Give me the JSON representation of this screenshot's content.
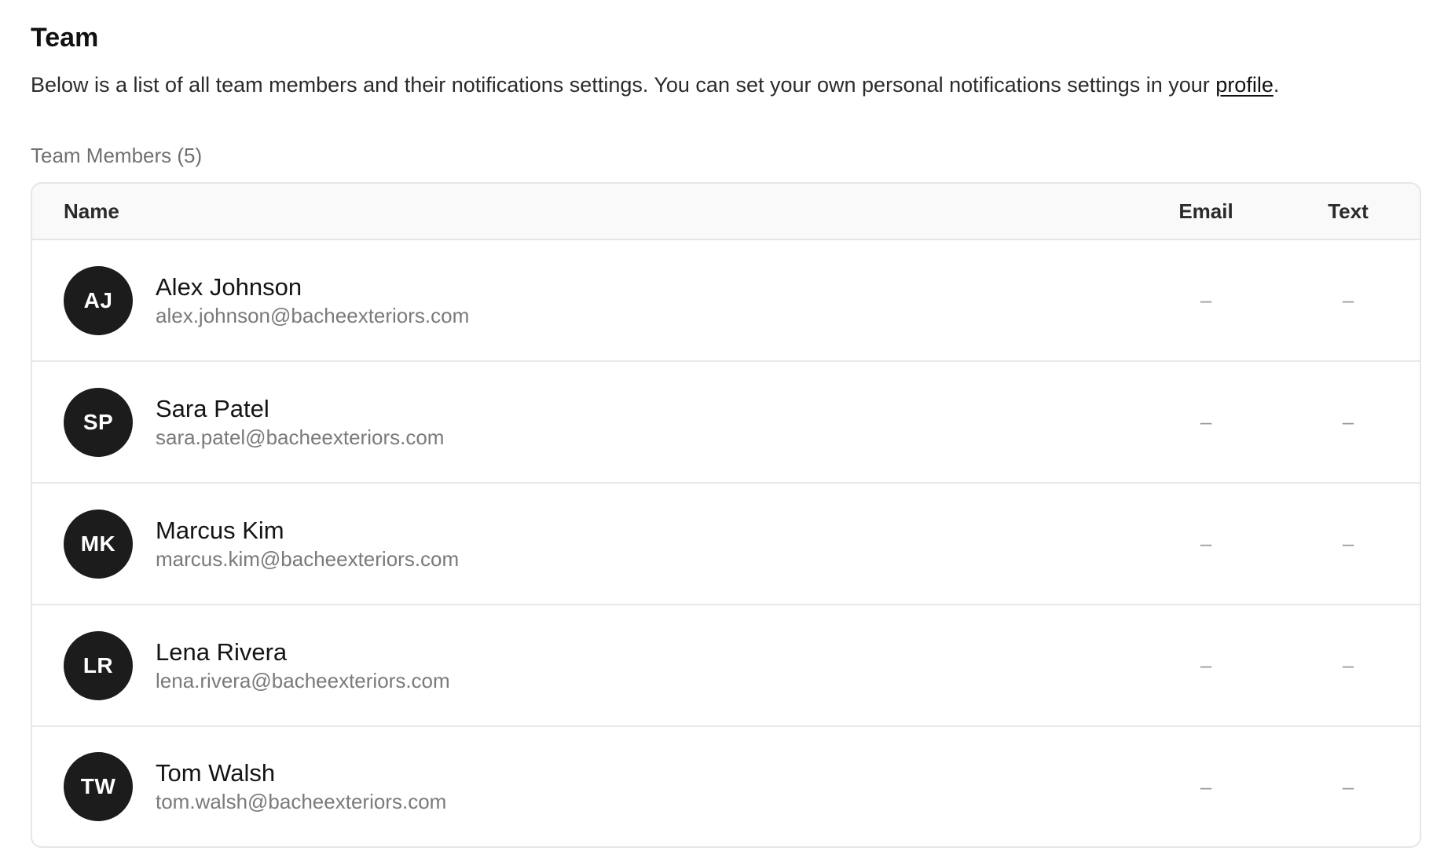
{
  "header": {
    "title": "Team",
    "description_before_link": "Below is a list of all team members and their notifications settings. You can set your own personal notifications settings in your ",
    "description_link": "profile",
    "description_after_link": "."
  },
  "section": {
    "label": "Team Members (5)"
  },
  "table": {
    "columns": {
      "name": "Name",
      "email": "Email",
      "text": "Text"
    },
    "rows": [
      {
        "initials": "AJ",
        "name": "Alex Johnson",
        "email": "alex.johnson@bacheexteriors.com",
        "email_setting": "–",
        "text_setting": "–"
      },
      {
        "initials": "SP",
        "name": "Sara Patel",
        "email": "sara.patel@bacheexteriors.com",
        "email_setting": "–",
        "text_setting": "–"
      },
      {
        "initials": "MK",
        "name": "Marcus Kim",
        "email": "marcus.kim@bacheexteriors.com",
        "email_setting": "–",
        "text_setting": "–"
      },
      {
        "initials": "LR",
        "name": "Lena Rivera",
        "email": "lena.rivera@bacheexteriors.com",
        "email_setting": "–",
        "text_setting": "–"
      },
      {
        "initials": "TW",
        "name": "Tom Walsh",
        "email": "tom.walsh@bacheexteriors.com",
        "email_setting": "–",
        "text_setting": "–"
      }
    ]
  },
  "colors": {
    "avatar_bg": "#1c1c1c",
    "header_bg": "#f9f9f9",
    "border": "#e6e6e6",
    "secondary_text": "#7a7a7a"
  }
}
